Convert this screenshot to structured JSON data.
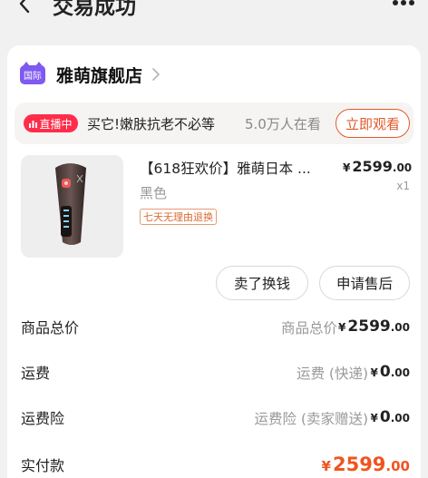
{
  "header": {
    "title": "交易成功"
  },
  "shop": {
    "badge": "国际",
    "name": "雅萌旗舰店"
  },
  "live": {
    "badge": "直播中",
    "title": "买它!嫩肤抗老不必等",
    "viewers": "5.0万人在看",
    "watch_button": "立即观看"
  },
  "product": {
    "title": "【618狂欢价】雅萌日本 ...",
    "price_currency": "¥",
    "price_integer": "2599",
    "price_decimal": ".00",
    "variant": "黑色",
    "quantity": "x1",
    "tag": "七天无理由退换"
  },
  "actions": {
    "resell": "卖了换钱",
    "after_sale": "申请售后"
  },
  "summary": {
    "goods_total": {
      "label": "商品总价",
      "sub": "商品总价",
      "currency": "¥",
      "integer": "2599",
      "decimal": ".00"
    },
    "shipping": {
      "label": "运费",
      "sub": "运费 (快递)",
      "currency": "¥",
      "integer": "0",
      "decimal": ".00"
    },
    "shipping_insurance": {
      "label": "运费险",
      "sub": "运费险 (卖家赠送)",
      "currency": "¥",
      "integer": "0",
      "decimal": ".00"
    },
    "paid": {
      "label": "实付款",
      "currency": "¥",
      "integer": "2599",
      "decimal": ".00"
    }
  },
  "colors": {
    "accent": "#f0541e",
    "live_red": "#ff2d4a",
    "shop_purple": "#7f5af0",
    "page_bg": "#f1f1f1"
  },
  "icons": {
    "back": "chevron-left-icon",
    "more": "more-dots-icon",
    "shop_arrow": "chevron-right-icon",
    "live_bars": "bar-chart-icon"
  }
}
